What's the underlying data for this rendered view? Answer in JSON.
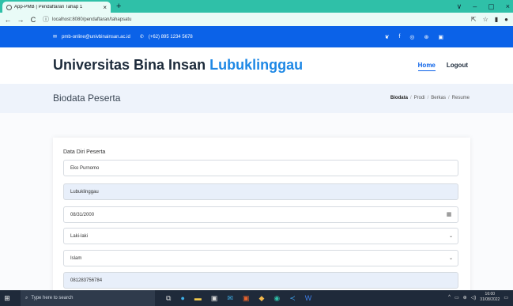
{
  "browser": {
    "tab_title": "App-PMB | Pendaftaran Tahap 1",
    "tab_close": "×",
    "new_tab": "+",
    "url": "localhost:8080/pendaftaran/tahapsatu",
    "back": "←",
    "forward": "→",
    "reload": "C",
    "info": "ⓘ",
    "share_icon": "⇱",
    "star_icon": "☆",
    "window_controls": [
      "∨",
      "–",
      "▢",
      "×"
    ]
  },
  "topbar": {
    "email": "pmb-online@univbinainsan.ac.id",
    "phone": "(+62) 895 1234 5678",
    "social_icons": [
      "twitter-icon",
      "facebook-icon",
      "instagram-icon",
      "skype-icon",
      "linkedin-icon"
    ]
  },
  "header": {
    "brand_main": "Universitas Bina Insan",
    "brand_accent": "Lubuklinggau",
    "nav": {
      "home": "Home",
      "logout": "Logout"
    }
  },
  "page": {
    "title": "Biodata Peserta",
    "breadcrumb": {
      "biodata": "Biodata",
      "prodi": "Prodi",
      "berkas": "Berkas",
      "resume": "Resume",
      "sep": "/"
    }
  },
  "form": {
    "label": "Data Diri Peserta",
    "fields": {
      "nama": "Eko Purnomo",
      "tempat_lahir": "Lubuklinggau",
      "tanggal_lahir": "08/31/2000",
      "jenis_kelamin": "Laki-laki",
      "agama": "Islam",
      "telepon": "081283756784"
    }
  },
  "taskbar": {
    "search_placeholder": "Type here to search",
    "time": "16:00",
    "date": "31/08/2022"
  },
  "colors": {
    "topbar": "#0b62e8",
    "accent": "#1e88e5",
    "tabbar": "#2fc0a8"
  }
}
